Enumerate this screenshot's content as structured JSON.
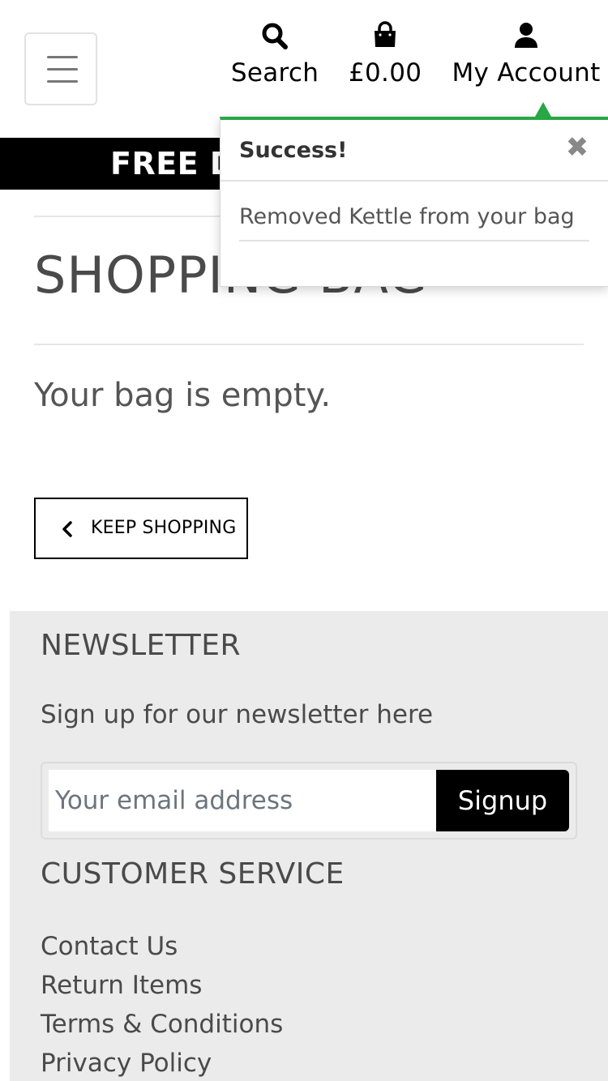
{
  "header": {
    "search_label": "Search",
    "bag_total": "£0.00",
    "account_label": "My Account",
    "icons": [
      "menu-icon",
      "search-icon",
      "shopping-bag-icon",
      "user-icon"
    ]
  },
  "banner": {
    "text": "FREE DE"
  },
  "main": {
    "title": "SHOPPING BAG",
    "empty_message": "Your bag is empty.",
    "keep_shopping_label": "KEEP SHOPPING"
  },
  "toast": {
    "title": "Success!",
    "message": "Removed Kettle from your bag",
    "close_glyph": "✖",
    "accent_color": "#28a745"
  },
  "footer": {
    "newsletter_heading": "NEWSLETTER",
    "newsletter_text": "Sign up for our newsletter here",
    "email_placeholder": "Your email address",
    "signup_label": "Signup",
    "customer_service_heading": "CUSTOMER SERVICE",
    "links": [
      "Contact Us",
      "Return Items",
      "Terms & Conditions",
      "Privacy Policy"
    ]
  }
}
